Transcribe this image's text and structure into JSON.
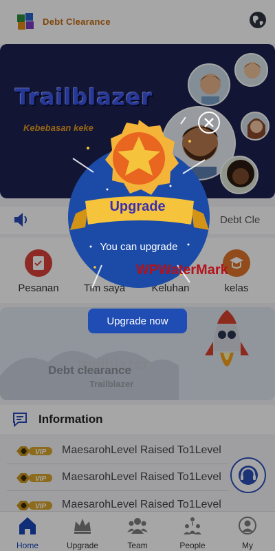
{
  "header": {
    "title": "Debt Clearance",
    "icons": [
      "app-logo",
      "globe-icon"
    ]
  },
  "banner": {
    "title": "Trailblazer",
    "subtitle": "Kebebasan keke"
  },
  "notice": {
    "text": "Debt Cle",
    "icon": "speaker-icon"
  },
  "quick_menu": [
    {
      "label": "Pesanan",
      "icon": "document-icon"
    },
    {
      "label": "Tim saya",
      "icon": "team-icon"
    },
    {
      "label": "Keluhan",
      "icon": "complaint-icon"
    },
    {
      "label": "kelas",
      "icon": "class-icon"
    }
  ],
  "promo": {
    "watermark": "trailblazer",
    "title": "Debt clearance",
    "subtitle": "Trailblazer"
  },
  "information": {
    "title": "Information",
    "items": [
      {
        "badge": "VIP",
        "text": "MaesarohLevel Raised To1Level"
      },
      {
        "badge": "VIP",
        "text": "MaesarohLevel Raised To1Level"
      },
      {
        "badge": "VIP",
        "text": "MaesarohLevel Raised To1Level"
      }
    ]
  },
  "bottom_nav": [
    {
      "label": "Home",
      "icon": "home-icon",
      "active": true
    },
    {
      "label": "Upgrade",
      "icon": "crown-icon",
      "active": false
    },
    {
      "label": "Team",
      "icon": "team-icon",
      "active": false
    },
    {
      "label": "People",
      "icon": "people-icon",
      "active": false
    },
    {
      "label": "My",
      "icon": "user-icon",
      "active": false
    }
  ],
  "modal": {
    "title": "Upgrade",
    "message": "You can upgrade",
    "button_label": "Upgrade now",
    "close_icon": "close-icon"
  },
  "watermark": "WPWaterMark",
  "colors": {
    "primary": "#1f4db4",
    "banner_bg": "#1d2250",
    "accent": "#e59a23",
    "modal_bg": "#1b4ba6"
  }
}
